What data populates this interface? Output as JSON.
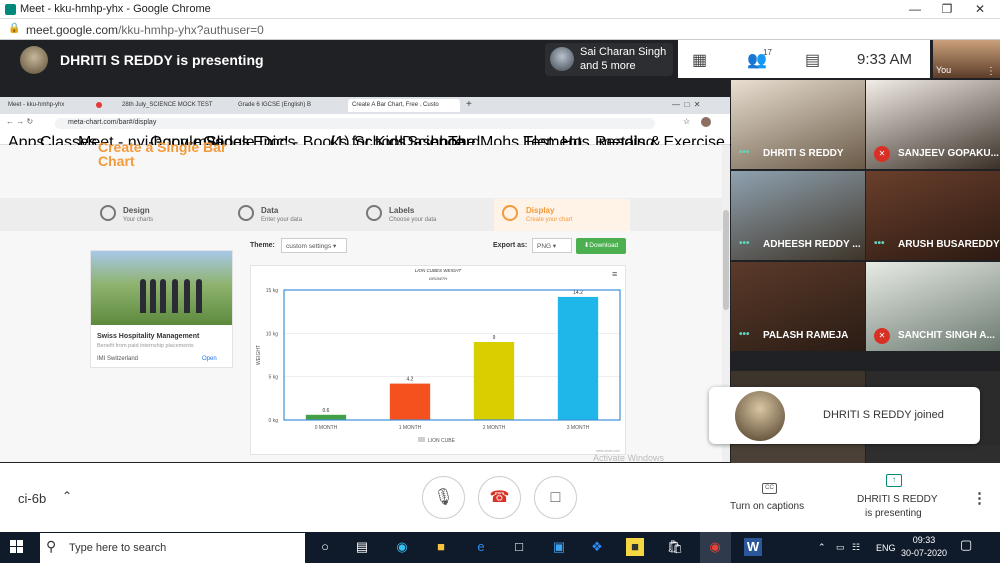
{
  "window": {
    "title": "Meet - kku-hmhp-yhx - Google Chrome",
    "url_host": "meet.google.com",
    "url_path": "/kku-hmhp-yhx?authuser=0"
  },
  "meet_top": {
    "presenting": "DHRITI S REDDY is presenting",
    "speaker_line1": "Sai Charan Singh",
    "speaker_line2": "and 5 more",
    "people_count": "17",
    "time": "9:33 AM",
    "you_label": "You"
  },
  "shared": {
    "tabs": [
      "Meet - kku-hmhp-yhx",
      "28th July_SCIENCE MOCK TEST",
      "Grade 6 IGCSE (English) B",
      "Create A Bar Chart, Free . Custo"
    ],
    "url": "meta-chart.com/bar#/display",
    "bookmarks": [
      "Apps",
      "Classes",
      "Meet - nyi-hqpv-mva",
      "Google Slides",
      "Google Docs",
      "Epic! - Books for Kids",
      "(1) School Science...",
      "Dashboard",
      "The Mohs Test: Ho...",
      "Elements, metals &...",
      "Reading: Exercise 3..."
    ],
    "heading_line1": "Create a Single Bar",
    "heading_line2": "Chart",
    "steps": [
      {
        "title": "Design",
        "sub": "Your charts"
      },
      {
        "title": "Data",
        "sub": "Enter your data"
      },
      {
        "title": "Labels",
        "sub": "Choose your data"
      },
      {
        "title": "Display",
        "sub": "Create your chart"
      }
    ],
    "theme_label": "Theme:",
    "theme_value": "custom settings",
    "export_label": "Export as:",
    "export_value": "PNG",
    "download": "Download",
    "ad_title": "Swiss Hospitality Management",
    "ad_sub": "Benefit from paid internship placements",
    "ad_company": "IMI Switzerland",
    "ad_open": "Open",
    "watermark": "Activate Windows"
  },
  "chart_data": {
    "type": "bar",
    "title": "LION CUBES WEIGHT",
    "subtitle": "GROWTH",
    "categories": [
      "0 MONTH",
      "1 MONTH",
      "2 MONTH",
      "3 MONTH"
    ],
    "values": [
      0.6,
      4.2,
      9,
      14.2
    ],
    "value_labels": [
      "0.6",
      "4.2",
      "9",
      "14.2"
    ],
    "colors": [
      "#43a047",
      "#f4511e",
      "#d9cf00",
      "#1fb6ea"
    ],
    "ylabel": "WEIGHT",
    "ylim": [
      0,
      15
    ],
    "yticks": [
      0,
      5,
      10,
      15
    ],
    "ytick_labels": [
      "0 kg",
      "5 kg",
      "10 kg",
      "15 kg"
    ],
    "legend": "LION CUBE",
    "credit": "meta-chart.com"
  },
  "participants": [
    {
      "name": "DHRITI S REDDY",
      "muted": false
    },
    {
      "name": "SANJEEV GOPAKU...",
      "muted": true
    },
    {
      "name": "ADHEESH REDDY ...",
      "muted": false
    },
    {
      "name": "ARUSH BUSAREDDY",
      "muted": false
    },
    {
      "name": "PALASH RAMEJA",
      "muted": false
    },
    {
      "name": "SANCHIT SINGH A...",
      "muted": true
    }
  ],
  "toast": {
    "text": "DHRITI S REDDY joined"
  },
  "bottom": {
    "meeting_code": "ci-6b",
    "captions": "Turn on captions",
    "presenting_line1": "DHRITI S REDDY",
    "presenting_line2": "is presenting"
  },
  "taskbar": {
    "search_placeholder": "Type here to search",
    "lang": "ENG",
    "time": "09:33",
    "date": "30-07-2020"
  }
}
